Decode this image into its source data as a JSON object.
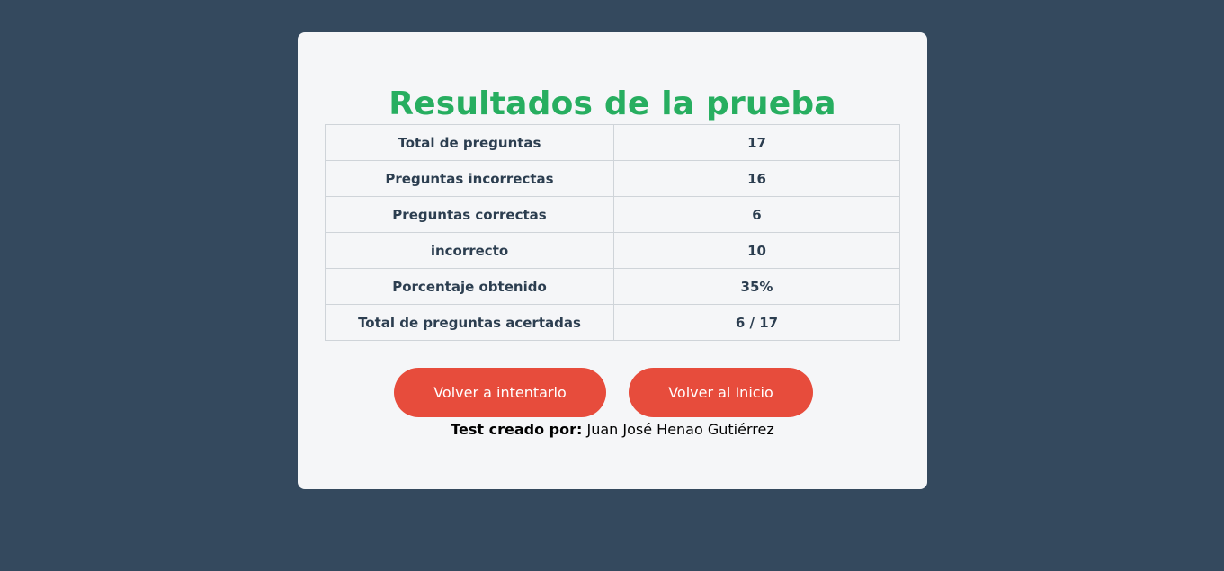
{
  "title": "Resultados de la prueba",
  "results": [
    {
      "label": "Total de preguntas",
      "value": "17"
    },
    {
      "label": "Preguntas incorrectas",
      "value": "16"
    },
    {
      "label": "Preguntas correctas",
      "value": "6"
    },
    {
      "label": "incorrecto",
      "value": "10"
    },
    {
      "label": "Porcentaje obtenido",
      "value": "35%"
    },
    {
      "label": "Total de preguntas acertadas",
      "value": "6 / 17"
    }
  ],
  "buttons": {
    "retry": "Volver a intentarlo",
    "home": "Volver al Inicio"
  },
  "credit": {
    "prefix": "Test creado por:",
    "author": "Juan José Henao Gutiérrez"
  },
  "colors": {
    "background": "#34495e",
    "card": "#f5f6f8",
    "title": "#27ae60",
    "button": "#e74c3c",
    "text": "#2c3e50"
  }
}
